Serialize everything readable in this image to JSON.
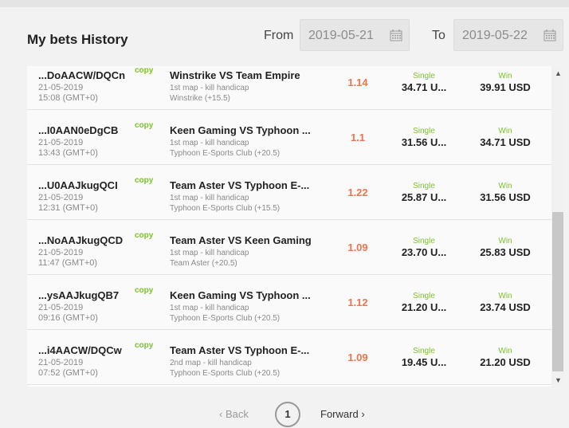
{
  "header": {
    "title": "My bets History",
    "from_label": "From",
    "from_value": "2019-05-21",
    "to_label": "To",
    "to_value": "2019-05-22"
  },
  "bets": [
    {
      "id": "...DoAACW/DQCn",
      "copy": "copy",
      "date": "21-05-2019",
      "time": "15:08 (GMT+0)",
      "match": "Winstrike VS Team Empire",
      "market": "1st map - kill handicap",
      "pick": "Winstrike (+15.5)",
      "odds": "1.14",
      "type": "Single",
      "stake": "34.71 U...",
      "result": "Win",
      "payout": "39.91 USD"
    },
    {
      "id": "...I0AAN0eDgCB",
      "copy": "copy",
      "date": "21-05-2019",
      "time": "13:43 (GMT+0)",
      "match": "Keen Gaming VS Typhoon ...",
      "market": "1st map - kill handicap",
      "pick": "Typhoon E-Sports Club (+20.5)",
      "odds": "1.1",
      "type": "Single",
      "stake": "31.56 U...",
      "result": "Win",
      "payout": "34.71 USD"
    },
    {
      "id": "...U0AAJkugQCI",
      "copy": "copy",
      "date": "21-05-2019",
      "time": "12:31 (GMT+0)",
      "match": "Team Aster VS Typhoon E-...",
      "market": "1st map - kill handicap",
      "pick": "Typhoon E-Sports Club (+15.5)",
      "odds": "1.22",
      "type": "Single",
      "stake": "25.87 U...",
      "result": "Win",
      "payout": "31.56 USD"
    },
    {
      "id": "...NoAAJkugQCD",
      "copy": "copy",
      "date": "21-05-2019",
      "time": "11:47 (GMT+0)",
      "match": "Team Aster VS Keen Gaming",
      "market": "1st map - kill handicap",
      "pick": "Team Aster (+20.5)",
      "odds": "1.09",
      "type": "Single",
      "stake": "23.70 U...",
      "result": "Win",
      "payout": "25.83 USD"
    },
    {
      "id": "...ysAAJkugQB7",
      "copy": "copy",
      "date": "21-05-2019",
      "time": "09:16 (GMT+0)",
      "match": "Keen Gaming VS Typhoon ...",
      "market": "1st map - kill handicap",
      "pick": "Typhoon E-Sports Club (+20.5)",
      "odds": "1.12",
      "type": "Single",
      "stake": "21.20 U...",
      "result": "Win",
      "payout": "23.74 USD"
    },
    {
      "id": "...i4AACW/DQCw",
      "copy": "copy",
      "date": "21-05-2019",
      "time": "07:52 (GMT+0)",
      "match": "Team Aster VS Typhoon E-...",
      "market": "2nd map - kill handicap",
      "pick": "Typhoon E-Sports Club (+20.5)",
      "odds": "1.09",
      "type": "Single",
      "stake": "19.45 U...",
      "result": "Win",
      "payout": "21.20 USD"
    }
  ],
  "pagination": {
    "back_label": "Back",
    "current_page": "1",
    "forward_label": "Forward"
  },
  "icons": {
    "calendar": "calendar-icon",
    "back": "chevron-left-icon",
    "forward": "chevron-right-icon"
  },
  "colors": {
    "accent_green": "#7cc42a",
    "odds_orange": "#f0734f"
  }
}
